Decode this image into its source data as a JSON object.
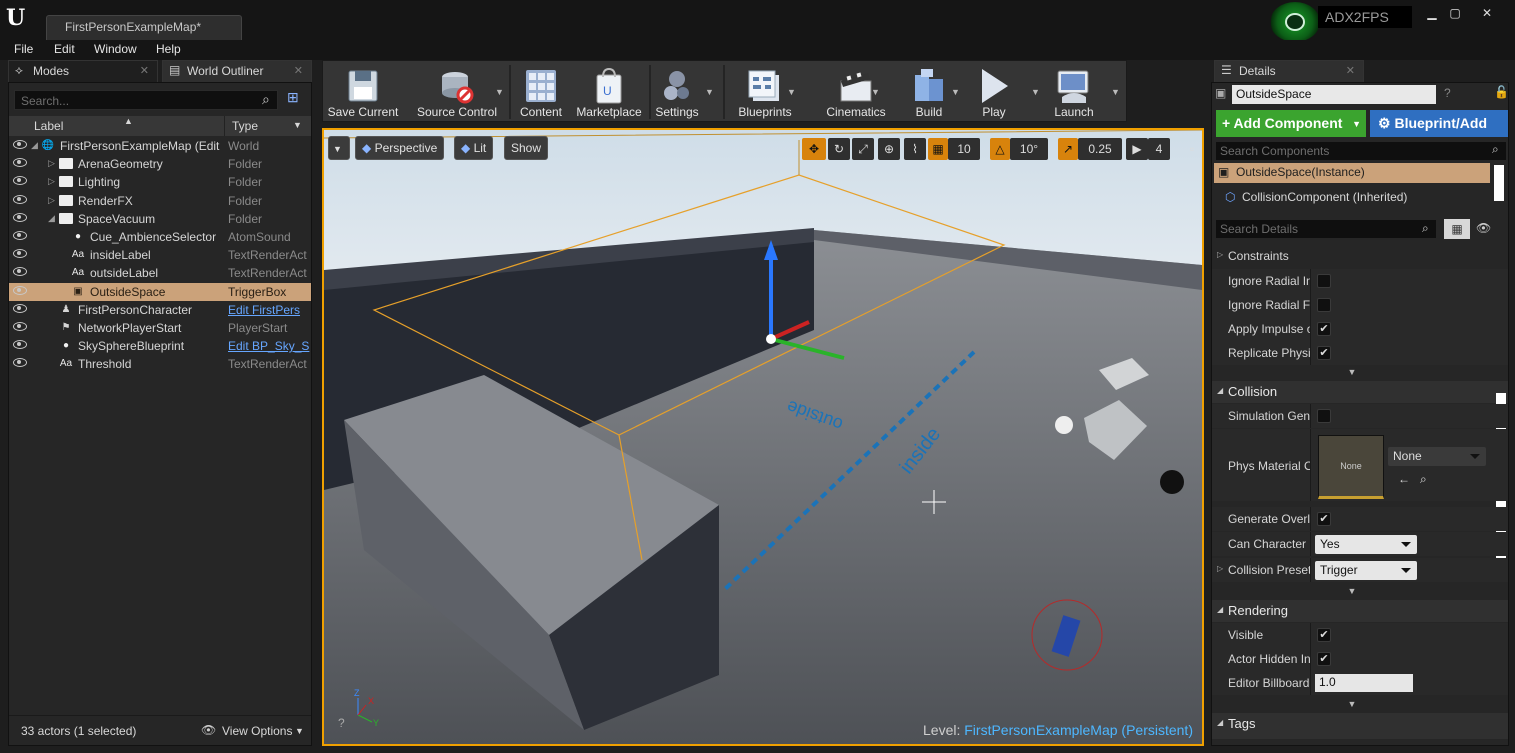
{
  "title": {
    "doc_tab": "FirstPersonExampleMap*",
    "project": "ADX2FPS",
    "logo": "unreal-logo",
    "project_icon": "project-shield-icon"
  },
  "menu": [
    "File",
    "Edit",
    "Window",
    "Help"
  ],
  "left_tabs": {
    "modes": "Modes",
    "outliner": "World Outliner"
  },
  "outliner": {
    "search_placeholder": "Search...",
    "col_label": "Label",
    "col_type": "Type",
    "rows": [
      {
        "label": "FirstPersonExampleMap (Edit",
        "type": "World",
        "icon": "world-icon",
        "level": 0
      },
      {
        "label": "ArenaGeometry",
        "type": "Folder",
        "icon": "folder-icon",
        "level": 1,
        "expand": "collapsed"
      },
      {
        "label": "Lighting",
        "type": "Folder",
        "icon": "folder-icon",
        "level": 1,
        "expand": "collapsed"
      },
      {
        "label": "RenderFX",
        "type": "Folder",
        "icon": "folder-icon",
        "level": 1,
        "expand": "collapsed"
      },
      {
        "label": "SpaceVacuum",
        "type": "Folder",
        "icon": "folder-open-icon",
        "level": 1,
        "expand": "expanded"
      },
      {
        "label": "Cue_AmbienceSelector",
        "type": "AtomSound",
        "icon": "sound-icon",
        "level": 2
      },
      {
        "label": "insideLabel",
        "type": "TextRenderAct",
        "icon": "text-render-icon",
        "level": 2
      },
      {
        "label": "outsideLabel",
        "type": "TextRenderAct",
        "icon": "text-render-icon",
        "level": 2
      },
      {
        "label": "OutsideSpace",
        "type": "TriggerBox",
        "icon": "trigger-box-icon",
        "level": 2,
        "selected": true
      },
      {
        "label": "FirstPersonCharacter",
        "type": "Edit FirstPers",
        "icon": "character-icon",
        "level": 1,
        "link": true
      },
      {
        "label": "NetworkPlayerStart",
        "type": "PlayerStart",
        "icon": "player-start-icon",
        "level": 1
      },
      {
        "label": "SkySphereBlueprint",
        "type": "Edit BP_Sky_S",
        "icon": "sphere-icon",
        "level": 1,
        "link": true
      },
      {
        "label": "Threshold",
        "type": "TextRenderAct",
        "icon": "text-render-icon",
        "level": 1
      }
    ],
    "actor_count": "33 actors (1 selected)",
    "view_options": "View Options"
  },
  "toolbar": [
    {
      "label": "Save Current",
      "icon": "save-icon"
    },
    {
      "label": "Source Control",
      "icon": "source-control-icon"
    },
    {
      "label": "Content",
      "icon": "content-icon"
    },
    {
      "label": "Marketplace",
      "icon": "marketplace-icon"
    },
    {
      "label": "Settings",
      "icon": "settings-icon"
    },
    {
      "label": "Blueprints",
      "icon": "blueprints-icon"
    },
    {
      "label": "Cinematics",
      "icon": "cinematics-icon"
    },
    {
      "label": "Build",
      "icon": "build-icon"
    },
    {
      "label": "Play",
      "icon": "play-icon"
    },
    {
      "label": "Launch",
      "icon": "launch-icon"
    }
  ],
  "viewport": {
    "perspective": "Perspective",
    "lit": "Lit",
    "show": "Show",
    "grid_snap": "10",
    "rot_snap": "10°",
    "scale_snap": "0.25",
    "cam_speed": "4",
    "level_prefix": "Level:",
    "level_name": "FirstPersonExampleMap (Persistent)",
    "floor_labels": {
      "outside": "outside",
      "inside": "inside"
    },
    "axis": {
      "x": "X",
      "y": "Y",
      "z": "Z"
    }
  },
  "details": {
    "tab": "Details",
    "actor_name": "OutsideSpace",
    "add_component": "+ Add Component",
    "blueprint": "Blueprint/Add",
    "search_components": "Search Components",
    "components": [
      "OutsideSpace(Instance)",
      "CollisionComponent (Inherited)"
    ],
    "search_details": "Search Details",
    "constraints": "Constraints",
    "physics_props": [
      {
        "name": "Ignore Radial Im",
        "checked": false
      },
      {
        "name": "Ignore Radial For",
        "checked": false
      },
      {
        "name": "Apply Impulse or",
        "checked": true
      },
      {
        "name": "Replicate Physic",
        "checked": true
      }
    ],
    "collision": {
      "title": "Collision",
      "sim_gen": "Simulation Gene",
      "phys_mat": "Phys Material O",
      "phys_thumb": "None",
      "phys_select": "None",
      "gen_overlap": "Generate Overla",
      "can_char": "Can Character S",
      "can_char_val": "Yes",
      "preset": "Collision Preset",
      "preset_val": "Trigger"
    },
    "rendering": {
      "title": "Rendering",
      "visible": "Visible",
      "hidden": "Actor Hidden In",
      "billboard": "Editor Billboard S",
      "billboard_val": "1.0"
    },
    "tags": "Tags"
  }
}
